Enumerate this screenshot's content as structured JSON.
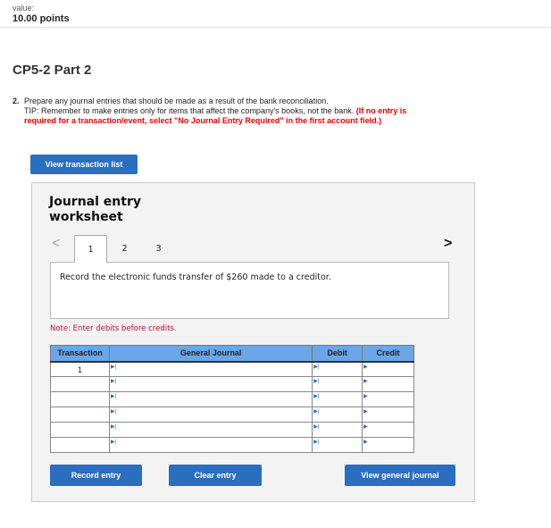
{
  "header": {
    "value_label": "value:",
    "points": "10.00 points"
  },
  "title": "CP5-2 Part 2",
  "question": {
    "number": "2.",
    "text": "Prepare any journal entries that should be made as a result of the bank reconciliation.",
    "tip": "TIP: Remember to make entries only for items that affect the company's books, not the bank.",
    "instruction": "(If no entry is required for a transaction/event, select \"No Journal Entry Required\" in the first account field.)"
  },
  "view_transaction_list": "View transaction list",
  "worksheet": {
    "title": "Journal entry worksheet",
    "tabs": [
      "1",
      "2",
      "3"
    ],
    "active_tab": "1",
    "prompt": "Record the electronic funds transfer of $260 made to a creditor.",
    "note": "Note: Enter debits before credits.",
    "columns": [
      "Transaction",
      "General Journal",
      "Debit",
      "Credit"
    ],
    "rows": [
      {
        "transaction": "1"
      },
      {
        "transaction": ""
      },
      {
        "transaction": ""
      },
      {
        "transaction": ""
      },
      {
        "transaction": ""
      },
      {
        "transaction": ""
      }
    ],
    "buttons": {
      "record": "Record entry",
      "clear": "Clear entry",
      "view_journal": "View general journal"
    }
  },
  "colors": {
    "accent": "#2a6ec0",
    "header_blue": "#6aa6e8",
    "note_red": "#c0102a"
  }
}
